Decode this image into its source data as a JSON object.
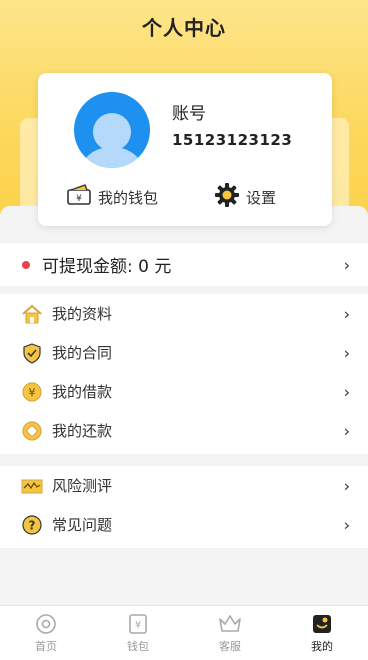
{
  "header": {
    "title": "个人中心"
  },
  "profile": {
    "account_label": "账号",
    "account_number": "15123123123",
    "wallet_label": "我的钱包",
    "settings_label": "设置"
  },
  "withdraw": {
    "text": "可提现金额: 0 元"
  },
  "menu_group_1": [
    {
      "label": "我的资料",
      "icon": "home-icon"
    },
    {
      "label": "我的合同",
      "icon": "shield-check-icon"
    },
    {
      "label": "我的借款",
      "icon": "yuan-coin-icon"
    },
    {
      "label": "我的还款",
      "icon": "repay-coin-icon"
    }
  ],
  "menu_group_2": [
    {
      "label": "风险测评",
      "icon": "risk-chart-icon"
    },
    {
      "label": "常见问题",
      "icon": "question-icon"
    }
  ],
  "tabbar": [
    {
      "label": "首页",
      "icon": "home-compass-icon",
      "active": false
    },
    {
      "label": "钱包",
      "icon": "wallet-yuan-icon",
      "active": false
    },
    {
      "label": "客服",
      "icon": "crown-icon",
      "active": false
    },
    {
      "label": "我的",
      "icon": "profile-icon",
      "active": true
    }
  ],
  "colors": {
    "accent_yellow": "#fcd75a",
    "avatar_blue": "#1e90ef",
    "alert_red": "#e8454b"
  }
}
